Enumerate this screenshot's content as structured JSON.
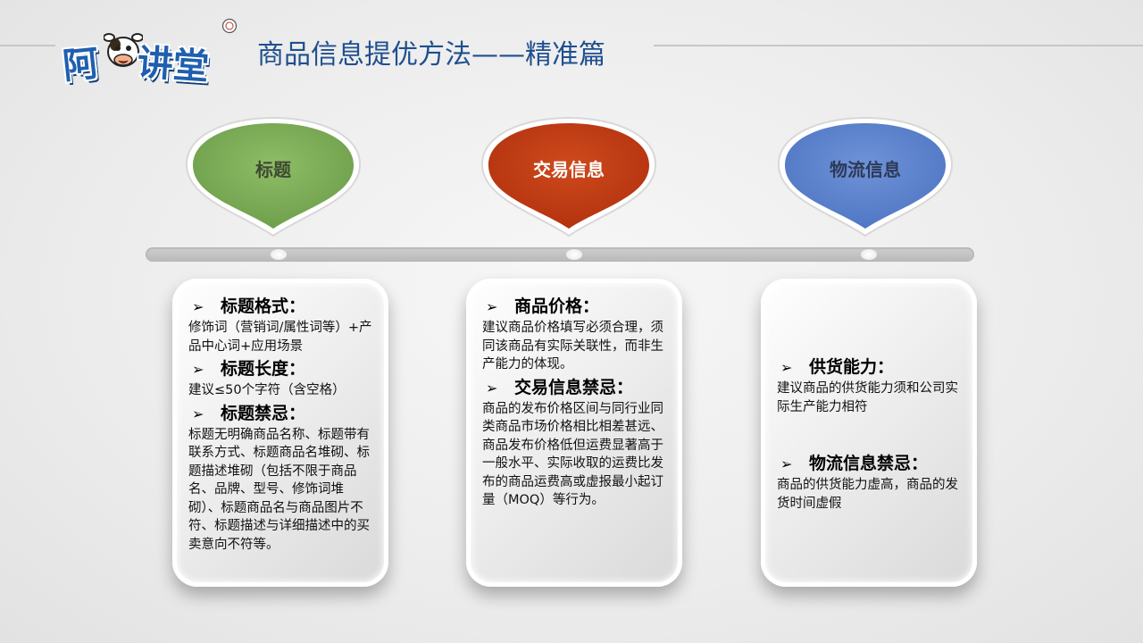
{
  "header": {
    "logo_alt": "阿牛讲堂",
    "logo_first": "阿",
    "logo_rest": "讲堂",
    "title": "商品信息提优方法——精准篇"
  },
  "colors": {
    "green": "#7fb05a",
    "red": "#c03a12",
    "blue": "#5e84cf",
    "title": "#1f4f8f"
  },
  "categories": [
    {
      "label": "标题",
      "icon": "green-drop"
    },
    {
      "label": "交易信息",
      "icon": "red-drop"
    },
    {
      "label": "物流信息",
      "icon": "blue-drop"
    }
  ],
  "cards": [
    {
      "sections": [
        {
          "heading": "标题格式：",
          "body": "修饰词（营销词/属性词等）+产品中心词+应用场景"
        },
        {
          "heading": "标题长度：",
          "body": "建议≤50个字符（含空格）"
        },
        {
          "heading": "标题禁忌：",
          "body": "标题无明确商品名称、标题带有联系方式、标题商品名堆砌、标题描述堆砌（包括不限于商品名、品牌、型号、修饰词堆砌）、标题商品名与商品图片不符、标题描述与详细描述中的买卖意向不符等。"
        }
      ]
    },
    {
      "sections": [
        {
          "heading": "商品价格：",
          "body": "建议商品价格填写必须合理，须同该商品有实际关联性，而非生产能力的体现。"
        },
        {
          "heading": "交易信息禁忌：",
          "body": "商品的发布价格区间与同行业同类商品市场价格相比相差甚远、商品发布价格低但运费显著高于一般水平、实际收取的运费比发布的商品运费高或虚报最小起订量（MOQ）等行为。"
        }
      ]
    },
    {
      "sections": [
        {
          "heading": "供货能力：",
          "body": "建议商品的供货能力须和公司实际生产能力相符"
        },
        {
          "heading": "物流信息禁忌：",
          "body": "商品的供货能力虚高，商品的发货时间虚假"
        }
      ]
    }
  ]
}
